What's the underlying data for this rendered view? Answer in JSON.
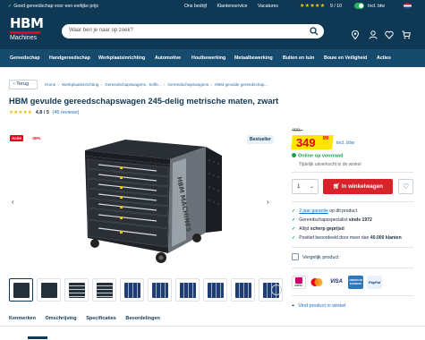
{
  "topbar": {
    "usp": "Goed gereedschap voor een eerlijke prijs",
    "links": [
      "Ons bedrijf",
      "Klantenservice",
      "Vacatures"
    ],
    "stars": "★★★★★",
    "score": "9 / 10",
    "vat_label": "Incl. btw"
  },
  "header": {
    "logo_top": "HBM",
    "logo_bottom": "Machines",
    "search_placeholder": "Waar ben je naar op zoek?"
  },
  "nav": {
    "items": [
      "Gereedschap",
      "Handgereedschap",
      "Werkplaatsinrichting",
      "Automotive",
      "Houtbewerking",
      "Metaalbewerking",
      "Buiten en tuin",
      "Bouw en Veiligheid",
      "Acties"
    ]
  },
  "breadcrumb": {
    "back": "Terug",
    "items": [
      "Home",
      "Werkplaatsinrichting",
      "Gereedschapswagens, -koffe...",
      "Gereedschapswagens",
      "HBM gevulde gereedschap..."
    ]
  },
  "product": {
    "title": "HBM gevulde gereedschapswagen 245-delig metrische maten, zwart",
    "stars": "★★★★★",
    "rating": "4.8 / 5",
    "reviews": "(45 reviews)",
    "badge_actie": "Actie",
    "badge_discount": "-30%",
    "badge_best": "Bestseller",
    "old_price": "499,-",
    "price": "349",
    "price_cents": "99",
    "price_note": "incl. btw",
    "stock": "Online op voorraad",
    "stock_store": "Tijdelijk uitverkocht in de winkel",
    "quantity": "1",
    "cart_button": "In winkelwagen",
    "compare": "Vergelijk product",
    "find_store": "Vind product in winkel"
  },
  "usps": [
    {
      "before": "",
      "link": "2 jaar garantie",
      "after": " op dit product"
    },
    {
      "before": "Gereedschapsspecialist ",
      "bold": "sinds 1972",
      "after": ""
    },
    {
      "before": "Altijd ",
      "bold": "scherp geprijsd",
      "after": ""
    },
    {
      "before": "Positief beoordeeld door meer dan ",
      "bold": "40.000 klanten",
      "after": ""
    }
  ],
  "payments": [
    "iDEAL",
    "",
    "VISA",
    "AMERICAN EXPRESS",
    "PayPal"
  ],
  "tabs": [
    "Kenmerken",
    "Omschrijving",
    "Specificaties",
    "Beoordelingen"
  ],
  "colors": {
    "header": "#0f3854",
    "nav": "#174b6e",
    "cta": "#d8232a",
    "price_bg": "#ffe600",
    "price": "#e3001b",
    "stock": "#1aa34a"
  }
}
